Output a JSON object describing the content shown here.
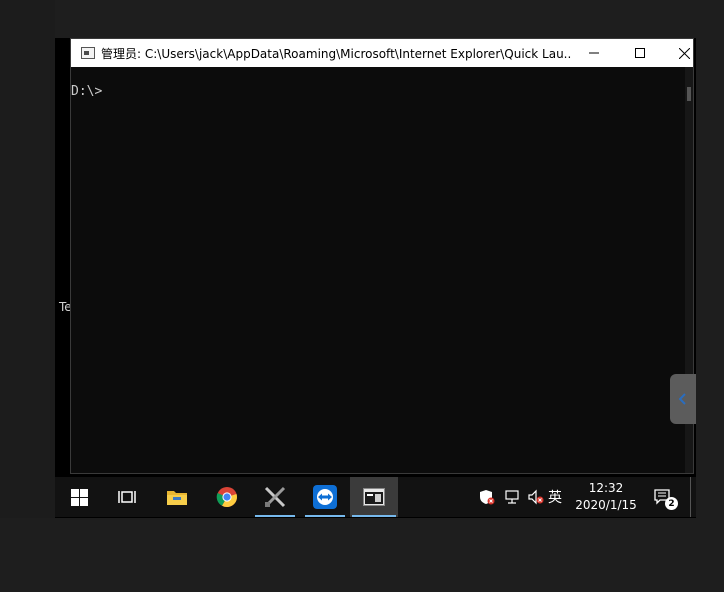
{
  "desktop": {
    "edge_label": "Te"
  },
  "window": {
    "title": "管理员: C:\\Users\\jack\\AppData\\Roaming\\Microsoft\\Internet Explorer\\Quick Lau...",
    "minimize_icon": "minimize-icon",
    "maximize_icon": "maximize-icon",
    "close_icon": "close-icon"
  },
  "console": {
    "prompt": "D:\\>"
  },
  "taskbar": {
    "items": [
      {
        "name": "start-button",
        "icon": "windows-logo-icon"
      },
      {
        "name": "task-view-button",
        "icon": "task-view-icon"
      },
      {
        "name": "file-explorer-button",
        "icon": "folder-icon"
      },
      {
        "name": "chrome-button",
        "icon": "chrome-icon"
      },
      {
        "name": "tools-button",
        "icon": "tools-icon"
      },
      {
        "name": "teamviewer-button",
        "icon": "teamviewer-icon"
      },
      {
        "name": "cmd-button",
        "icon": "cmd-icon"
      }
    ],
    "tray": {
      "ime": "英",
      "time": "12:32",
      "date": "2020/1/15",
      "notification_count": "2"
    }
  },
  "colors": {
    "taskbar_bg": "#121212",
    "active_indicator": "#76b9ed",
    "console_bg": "#0c0c0c",
    "console_text": "#cccccc"
  }
}
